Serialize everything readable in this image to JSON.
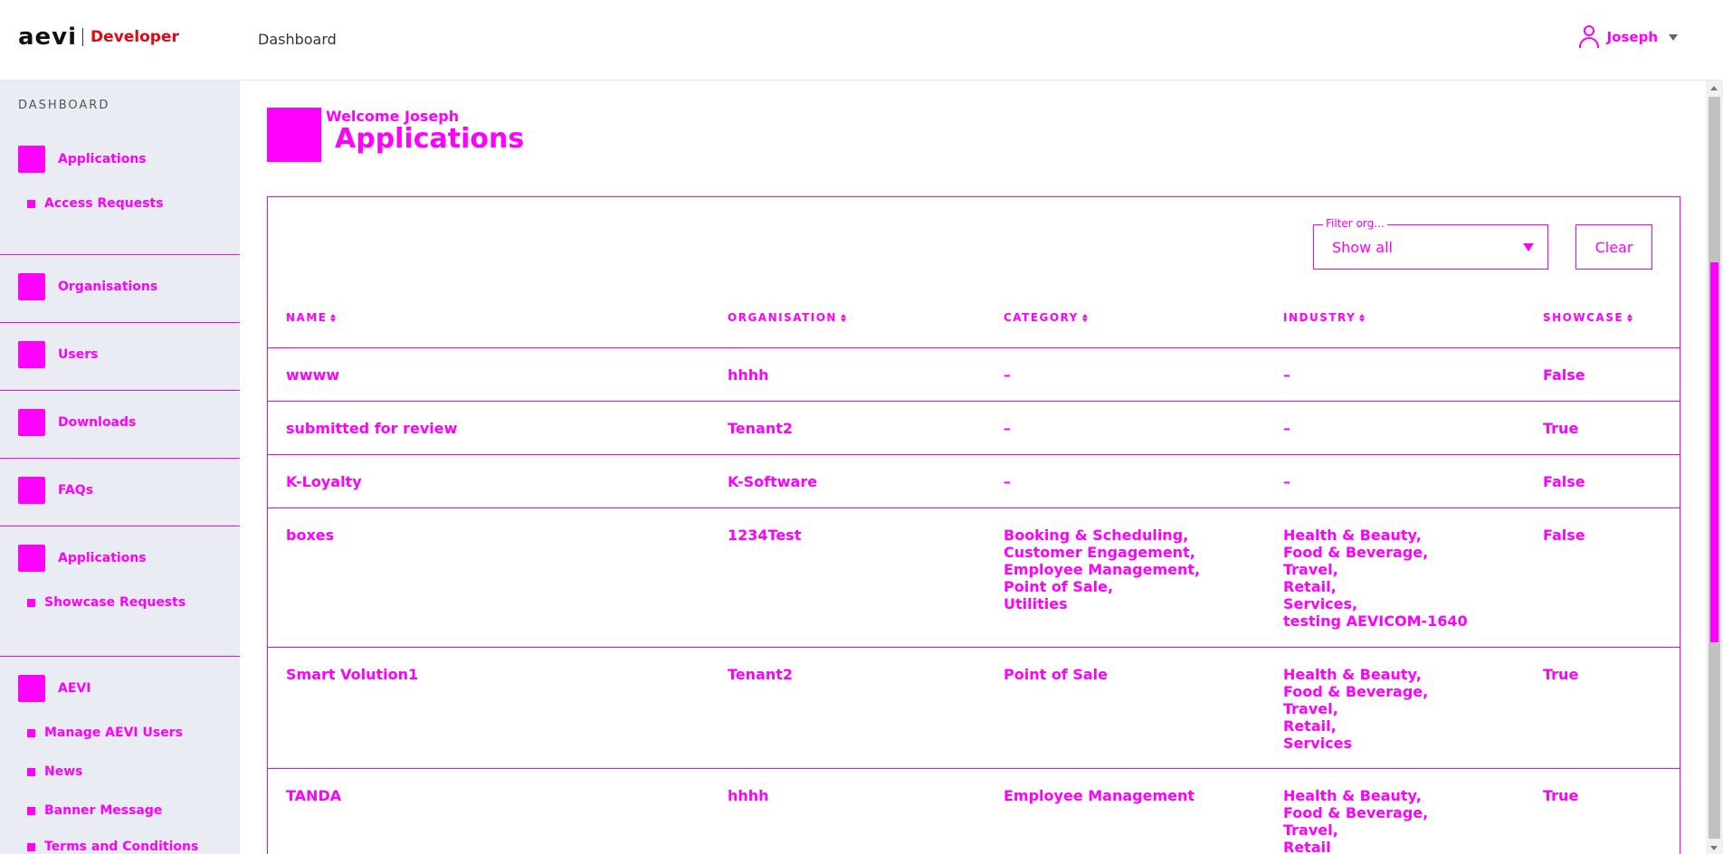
{
  "header": {
    "logo_text": "aevi",
    "logo_product": "Developer",
    "nav_item": "Dashboard",
    "user_name": "Joseph"
  },
  "sidebar": {
    "title": "DASHBOARD",
    "sections": [
      {
        "label": "Applications",
        "subitems": [
          "Access Requests"
        ]
      },
      {
        "label": "Organisations",
        "subitems": []
      },
      {
        "label": "Users",
        "subitems": []
      },
      {
        "label": "Downloads",
        "subitems": []
      },
      {
        "label": "FAQs",
        "subitems": []
      },
      {
        "label": "Applications",
        "subitems": [
          "Showcase Requests"
        ]
      },
      {
        "label": "AEVI",
        "subitems": [
          "Manage AEVI Users",
          "News",
          "Banner Message",
          "Terms and Conditions"
        ]
      }
    ]
  },
  "page": {
    "welcome": "Welcome Joseph",
    "title": "Applications"
  },
  "filter": {
    "legend": "Filter org...",
    "value": "Show all",
    "clear_label": "Clear"
  },
  "table": {
    "columns": [
      "NAME",
      "ORGANISATION",
      "CATEGORY",
      "INDUSTRY",
      "SHOWCASE"
    ],
    "rows": [
      {
        "name": "wwww",
        "organisation": "hhhh",
        "category": [
          "–"
        ],
        "industry": [
          "–"
        ],
        "showcase": "False"
      },
      {
        "name": "submitted for review",
        "organisation": "Tenant2",
        "category": [
          "–"
        ],
        "industry": [
          "–"
        ],
        "showcase": "True"
      },
      {
        "name": "K-Loyalty",
        "organisation": "K-Software",
        "category": [
          "–"
        ],
        "industry": [
          "–"
        ],
        "showcase": "False"
      },
      {
        "name": "boxes",
        "organisation": "1234Test",
        "category": [
          "Booking & Scheduling,",
          "Customer Engagement,",
          "Employee Management,",
          "Point of Sale,",
          "Utilities"
        ],
        "industry": [
          "Health & Beauty,",
          "Food & Beverage,",
          "Travel,",
          "Retail,",
          "Services,",
          "testing AEVICOM-1640"
        ],
        "showcase": "False"
      },
      {
        "name": "Smart Volution1",
        "organisation": "Tenant2",
        "category": [
          "Point of Sale"
        ],
        "industry": [
          "Health & Beauty,",
          "Food & Beverage,",
          "Travel,",
          "Retail,",
          "Services"
        ],
        "showcase": "True"
      },
      {
        "name": "TANDA",
        "organisation": "hhhh",
        "category": [
          "Employee Management"
        ],
        "industry": [
          "Health & Beauty,",
          "Food & Beverage,",
          "Travel,",
          "Retail"
        ],
        "showcase": "True"
      }
    ]
  },
  "colors": {
    "accent": "#ff00ff",
    "brand_red": "#e30613",
    "sidebar_bg": "#e9edf3"
  }
}
